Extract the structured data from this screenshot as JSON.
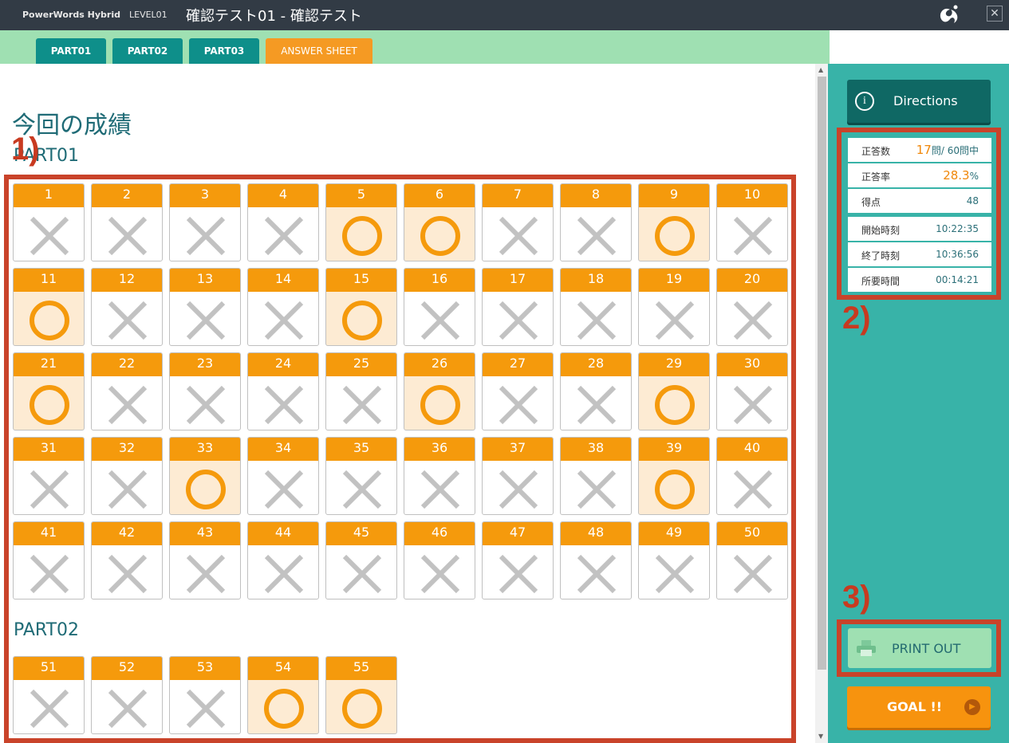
{
  "window": {
    "app_name": "PowerWords Hybrid",
    "level": "LEVEL01",
    "title": "確認テスト01 - 確認テスト",
    "logo_icon": "swirl-logo-icon",
    "close_glyph": "✕"
  },
  "tabs": [
    {
      "label": "PART01",
      "active": false
    },
    {
      "label": "PART02",
      "active": false
    },
    {
      "label": "PART03",
      "active": false
    },
    {
      "label": "ANSWER SHEET",
      "active": true
    }
  ],
  "main": {
    "heading": "今回の成績",
    "parts": [
      {
        "label": "PART01",
        "first": 1,
        "count": 50
      },
      {
        "label": "PART02",
        "first": 51,
        "count": 5
      }
    ],
    "correct_questions": [
      5,
      6,
      9,
      11,
      15,
      21,
      26,
      29,
      33,
      39,
      54,
      55
    ]
  },
  "annotations": {
    "a1": "1)",
    "a2": "2)",
    "a3": "3)"
  },
  "side": {
    "directions_label": "Directions",
    "directions_icon": "info-icon",
    "stats": {
      "correct_count_label": "正答数",
      "correct_count_value": "17",
      "correct_count_suffix": "問/ 60問中",
      "rate_label": "正答率",
      "rate_value": "28.3",
      "rate_unit": "%",
      "score_label": "得点",
      "score_value": "48",
      "start_label": "開始時刻",
      "start_value": "10:22:35",
      "end_label": "終了時刻",
      "end_value": "10:36:56",
      "elapsed_label": "所要時間",
      "elapsed_value": "00:14:21"
    },
    "print_label": "PRINT OUT",
    "print_icon": "printer-icon",
    "goal_label": "GOAL !!",
    "goal_icon": "play-circle-icon"
  },
  "colors": {
    "titlebar": "#323b45",
    "tab": "#0e8f8a",
    "tab_active": "#f59a23",
    "panel": "#38b3a8",
    "accent_orange": "#f59a0c",
    "correct_bg": "#fdebd3",
    "annotation_red": "#c9432a"
  }
}
